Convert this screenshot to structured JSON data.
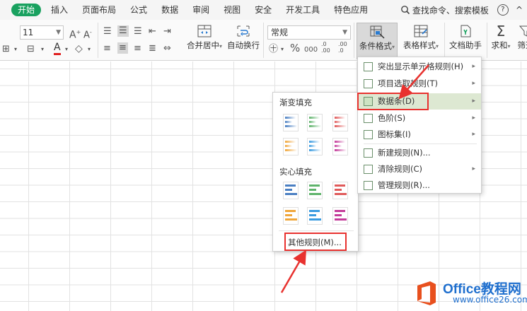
{
  "menubar": {
    "tabs": [
      {
        "label": "开始",
        "active": true
      },
      {
        "label": "插入"
      },
      {
        "label": "页面布局"
      },
      {
        "label": "公式"
      },
      {
        "label": "数据"
      },
      {
        "label": "审阅"
      },
      {
        "label": "视图"
      },
      {
        "label": "安全"
      },
      {
        "label": "开发工具"
      },
      {
        "label": "特色应用"
      }
    ],
    "search_label": "查找命令、搜索模板",
    "help_label": "?",
    "collapse_label": "^"
  },
  "ribbon": {
    "font_size": "11",
    "number_format": "常规",
    "merge_label": "合并居中",
    "wrap_label": "自动换行",
    "percent_label": "%",
    "thousands_label": "000",
    "cond_format_label": "条件格式",
    "table_style_label": "表格样式",
    "doc_assistant_label": "文档助手",
    "sum_label": "求和",
    "filter_label": "筛选"
  },
  "dropdown": {
    "items": [
      {
        "label": "突出显示单元格规则(H)",
        "arrow": "▸"
      },
      {
        "label": "项目选取规则(T)",
        "arrow": "▸"
      },
      {
        "label": "数据条(D)",
        "arrow": "▸",
        "highlighted": true
      },
      {
        "label": "色阶(S)",
        "arrow": "▸"
      },
      {
        "label": "图标集(I)",
        "arrow": "▸"
      },
      {
        "label": "新建规则(N)..."
      },
      {
        "label": "清除规则(C)",
        "arrow": "▸"
      },
      {
        "label": "管理规则(R)..."
      }
    ]
  },
  "submenu": {
    "gradient_header": "渐变填充",
    "solid_header": "实心填充",
    "other_rules": "其他规则(M)...",
    "swatch_colors": [
      "#4a7fc2",
      "#5fb36b",
      "#e05a5a",
      "#f0a63a",
      "#3a9be0",
      "#c43c9a"
    ]
  },
  "watermark": {
    "brand": "Office教程网",
    "url": "www.office26.com"
  },
  "colors": {
    "accent_green": "#19a15f",
    "annotation_red": "#e8322f",
    "highlight": "#dde8d2",
    "watermark_blue": "#1f6fce"
  }
}
